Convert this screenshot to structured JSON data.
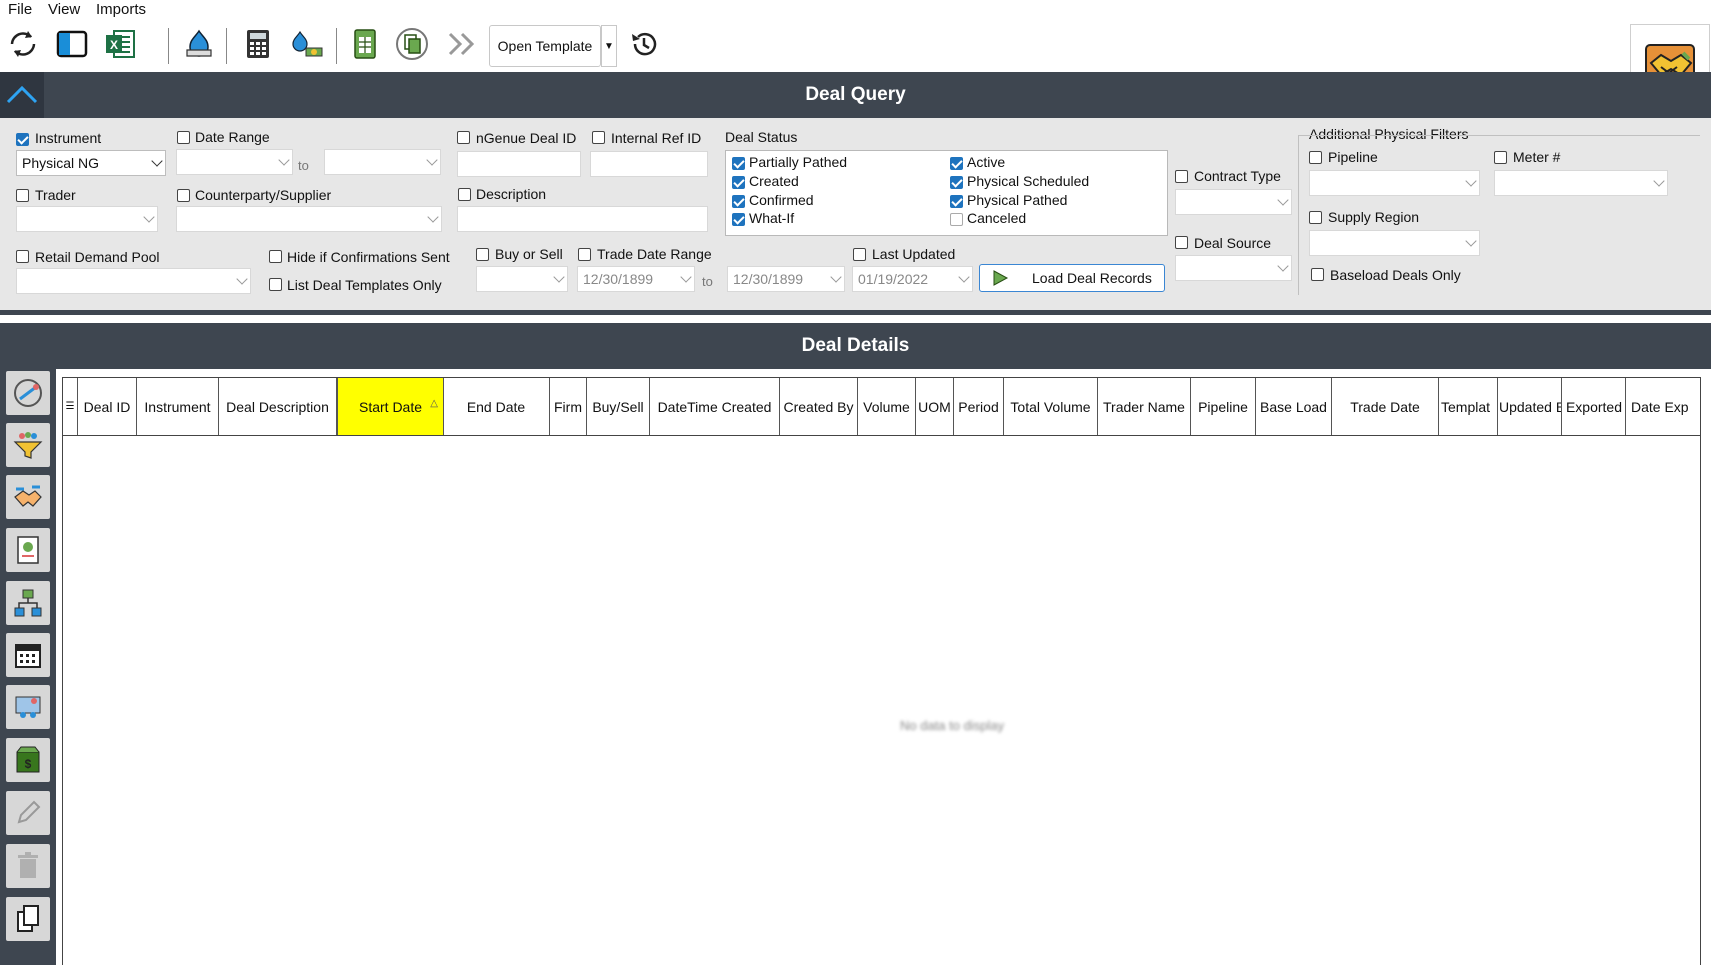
{
  "menu": {
    "file": "File",
    "view": "View",
    "imports": "Imports"
  },
  "toolbar": {
    "open_template": "Open Template",
    "icons": [
      "refresh-icon",
      "layout-icon",
      "excel-icon",
      "gas-flame-icon",
      "calculator-icon",
      "pipeline-money-icon",
      "spreadsheet-icon",
      "copy-cycle-icon",
      "double-chevron-icon",
      "history-icon"
    ]
  },
  "query": {
    "title": "Deal Query",
    "instrument_label": "Instrument",
    "instrument_value": "Physical NG",
    "date_range_label": "Date Range",
    "to_label": "to",
    "ngenue_deal_id_label": "nGenue Deal ID",
    "internal_ref_id_label": "Internal Ref ID",
    "trader_label": "Trader",
    "counterparty_label": "Counterparty/Supplier",
    "description_label": "Description",
    "retail_demand_pool_label": "Retail Demand Pool",
    "hide_confirmations_label": "Hide if Confirmations Sent",
    "list_templates_label": "List Deal Templates Only",
    "buy_or_sell_label": "Buy or Sell",
    "trade_date_range_label": "Trade Date Range",
    "trade_date_from": "12/30/1899",
    "trade_date_to": "12/30/1899",
    "last_updated_label": "Last Updated",
    "last_updated_value": "01/19/2022",
    "load_button": "Load Deal Records",
    "deal_status": {
      "label": "Deal Status",
      "items": [
        {
          "label": "Partially Pathed",
          "checked": true
        },
        {
          "label": "Created",
          "checked": true
        },
        {
          "label": "Confirmed",
          "checked": true
        },
        {
          "label": "What-If",
          "checked": true
        },
        {
          "label": "Active",
          "checked": true
        },
        {
          "label": "Physical Scheduled",
          "checked": true
        },
        {
          "label": "Physical Pathed",
          "checked": true
        },
        {
          "label": "Canceled",
          "checked": false
        }
      ]
    },
    "contract_type_label": "Contract Type",
    "deal_source_label": "Deal Source",
    "additional": {
      "label": "Additional Physical Filters",
      "pipeline_label": "Pipeline",
      "meter_label": "Meter #",
      "supply_region_label": "Supply Region",
      "baseload_label": "Baseload Deals Only"
    }
  },
  "details": {
    "title": "Deal Details",
    "columns": [
      "Deal ID",
      "Instrument",
      "Deal Description",
      "Start Date",
      "End Date",
      "Firm",
      "Buy/Sell",
      "DateTime Created",
      "Created By",
      "Volume",
      "UOM",
      "Period",
      "Total Volume",
      "Trader Name",
      "Pipeline",
      "Base Load",
      "Trade Date",
      "Templat",
      "Updated By",
      "Exported",
      "Date Exp"
    ],
    "no_data": "No data to display",
    "sorted_column": "Start Date",
    "highlight_color": "#ffff00"
  },
  "side_rail": [
    "pipeline-wrench-icon",
    "funnel-people-icon",
    "handshake-icon",
    "contract-icon",
    "network-icon",
    "calendar-icon",
    "meeting-icon",
    "cash-box-icon",
    "pencil-icon",
    "trash-icon",
    "copy-icon"
  ],
  "colors": {
    "header_bg": "#3e4650",
    "panel_bg": "#e7e7e7",
    "accent": "#1e73be"
  }
}
